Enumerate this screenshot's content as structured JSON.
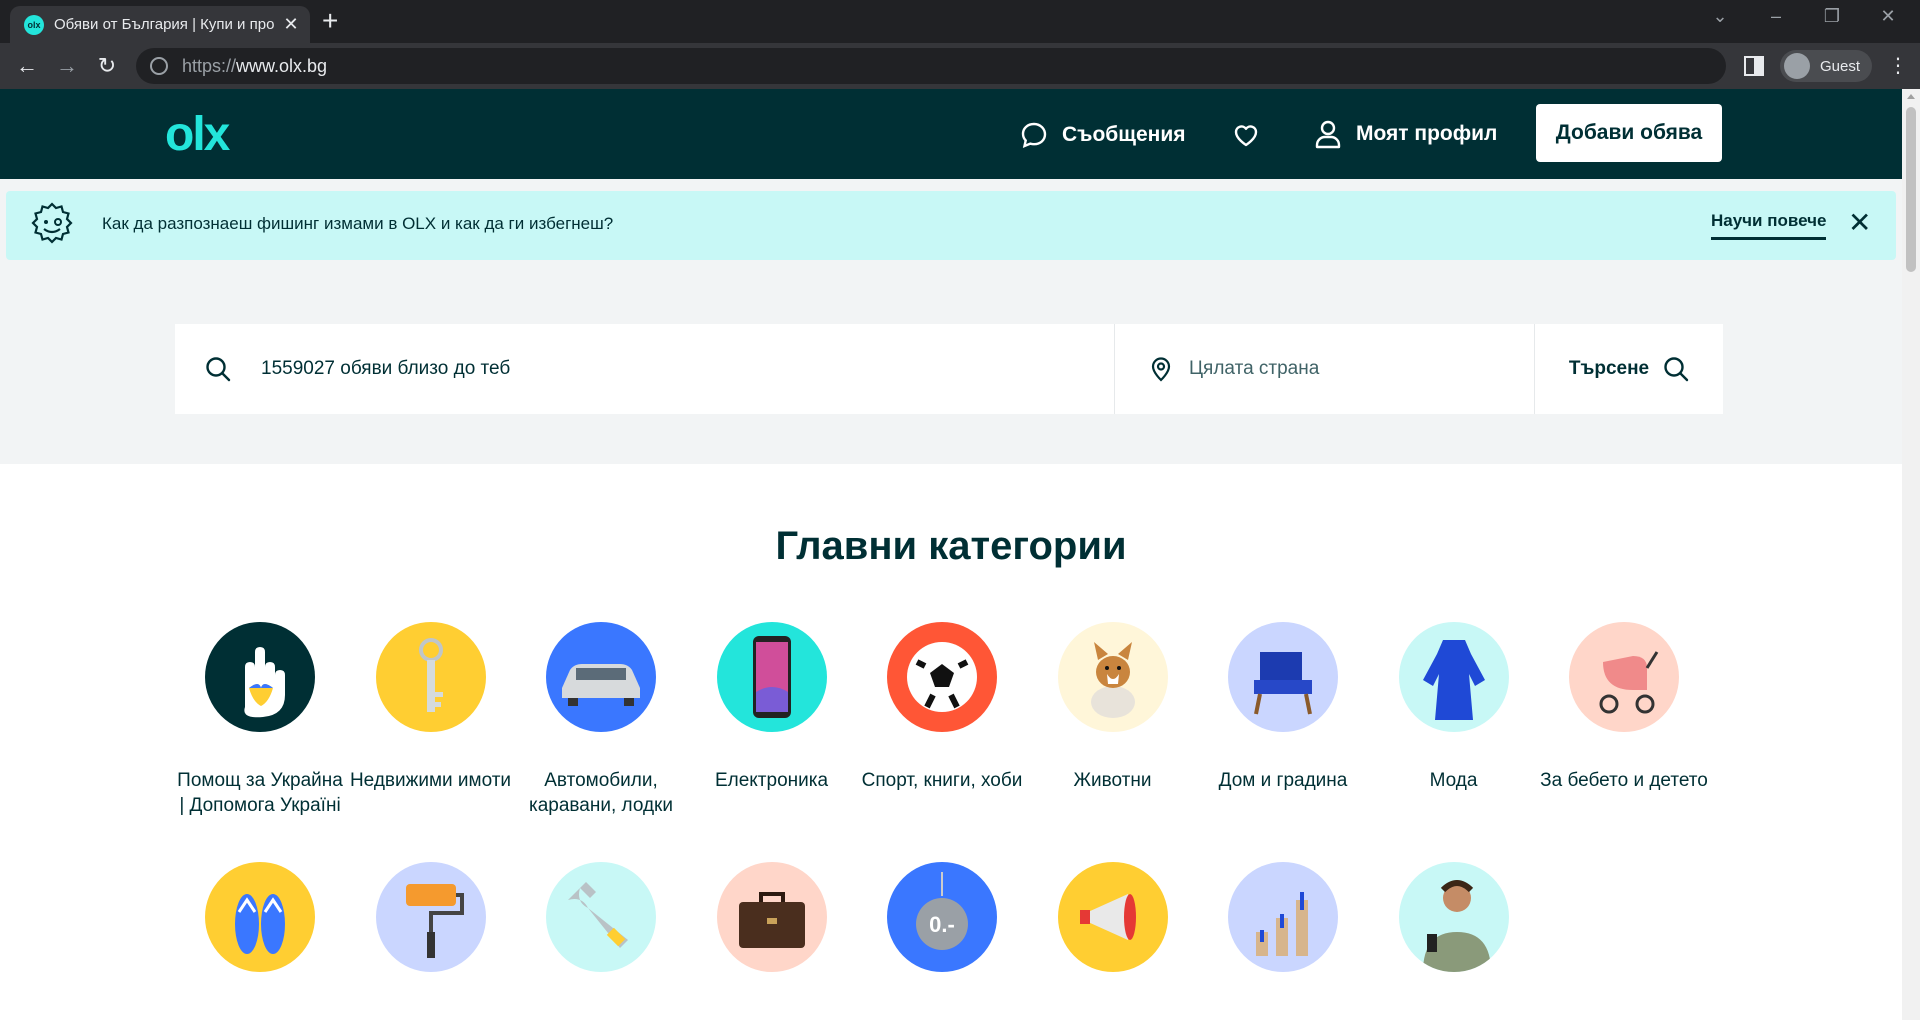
{
  "browser": {
    "tab_title": "Обяви от България | Купи и продай",
    "url_prefix": "https://",
    "url_host": "www.olx.bg",
    "profile_label": "Guest"
  },
  "header": {
    "logo": "olx",
    "messages": "Съобщения",
    "profile": "Моят профил",
    "add_ad": "Добави обява"
  },
  "banner": {
    "text": "Как да разпознаеш фишинг измами в OLX и как да ги избегнеш?",
    "link": "Научи повече"
  },
  "search": {
    "query_placeholder": "1559027 обяви близо до теб",
    "location_placeholder": "Цялата страна",
    "button": "Търсене"
  },
  "categories": {
    "title": "Главни категории",
    "items": [
      {
        "label": "Помощ за Украйна | Допомога Україні",
        "icon": "ukraine-help-hand-icon",
        "color": "#002f34"
      },
      {
        "label": "Недвижими имоти",
        "icon": "key-icon",
        "color": "#ffce32"
      },
      {
        "label": "Автомобили, каравани, лодки",
        "icon": "car-icon",
        "color": "#3a77ff"
      },
      {
        "label": "Електроника",
        "icon": "smartphone-icon",
        "color": "#23e5db"
      },
      {
        "label": "Спорт, книги, хоби",
        "icon": "football-icon",
        "color": "#ff5636"
      },
      {
        "label": "Животни",
        "icon": "dog-icon",
        "color": "#fff6d9"
      },
      {
        "label": "Дом и градина",
        "icon": "armchair-icon",
        "color": "#cad6ff"
      },
      {
        "label": "Мода",
        "icon": "dress-icon",
        "color": "#c8f8f6"
      },
      {
        "label": "За бебето и детето",
        "icon": "stroller-icon",
        "color": "#ffd6c9"
      }
    ],
    "row2": [
      {
        "icon": "flip-flops-icon",
        "color": "#ffce32"
      },
      {
        "icon": "paint-roller-icon",
        "color": "#cad6ff"
      },
      {
        "icon": "wrench-icon",
        "color": "#c8f8f6"
      },
      {
        "icon": "briefcase-icon",
        "color": "#ffd6c9"
      },
      {
        "icon": "price-tag-icon",
        "color": "#3a77ff"
      },
      {
        "icon": "megaphone-icon",
        "color": "#ffce32"
      },
      {
        "icon": "growth-chart-icon",
        "color": "#cad6ff"
      },
      {
        "icon": "person-phone-icon",
        "color": "#c8f8f6"
      }
    ]
  }
}
